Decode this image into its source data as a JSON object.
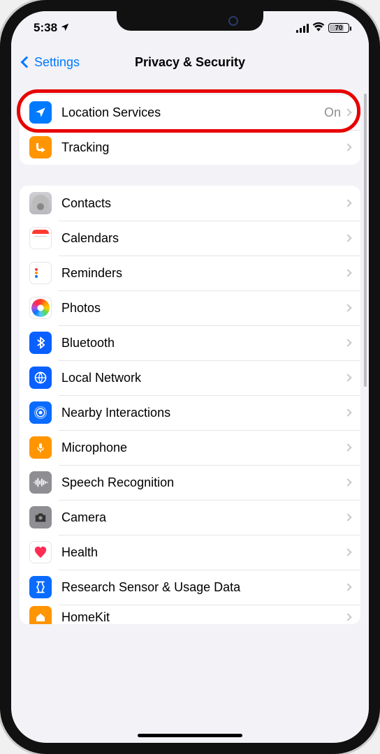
{
  "statusbar": {
    "time": "5:38",
    "battery_pct": "70"
  },
  "nav": {
    "back_label": "Settings",
    "title": "Privacy & Security"
  },
  "groups": {
    "g1": {
      "location_services": {
        "label": "Location Services",
        "value": "On"
      },
      "tracking": {
        "label": "Tracking"
      }
    },
    "g2": {
      "contacts": {
        "label": "Contacts"
      },
      "calendars": {
        "label": "Calendars"
      },
      "reminders": {
        "label": "Reminders"
      },
      "photos": {
        "label": "Photos"
      },
      "bluetooth": {
        "label": "Bluetooth"
      },
      "local_network": {
        "label": "Local Network"
      },
      "nearby": {
        "label": "Nearby Interactions"
      },
      "microphone": {
        "label": "Microphone"
      },
      "speech": {
        "label": "Speech Recognition"
      },
      "camera": {
        "label": "Camera"
      },
      "health": {
        "label": "Health"
      },
      "research": {
        "label": "Research Sensor & Usage Data"
      },
      "homekit": {
        "label": "HomeKit"
      }
    }
  }
}
